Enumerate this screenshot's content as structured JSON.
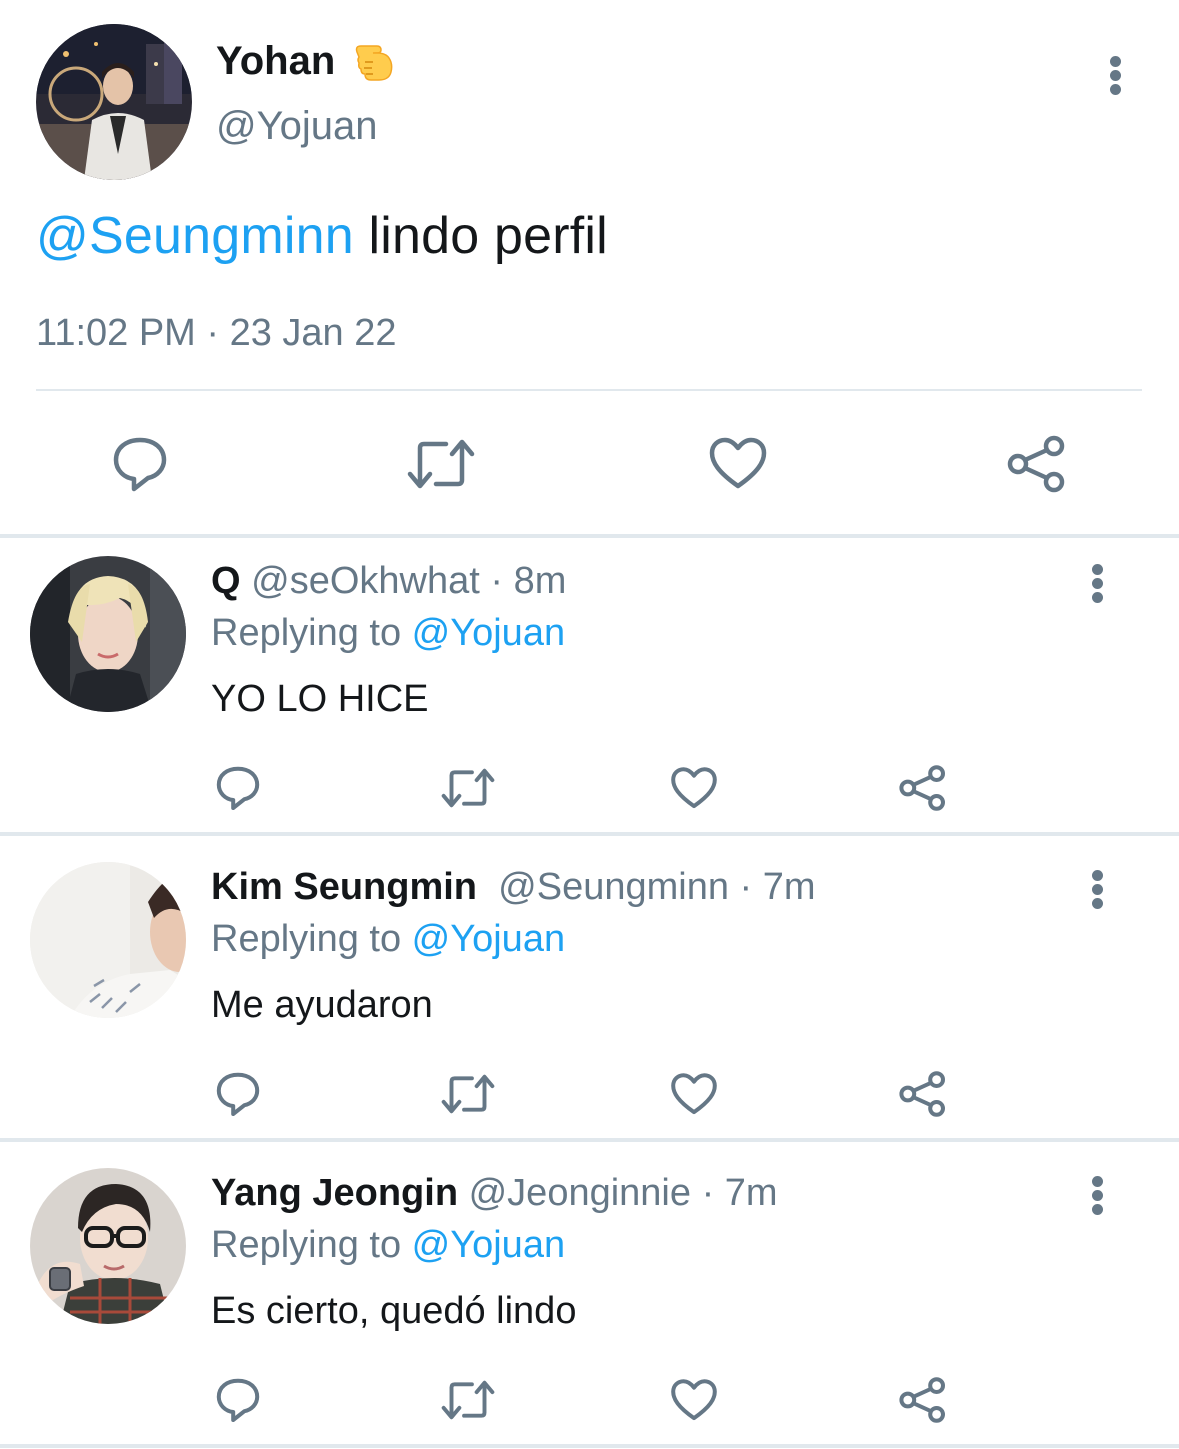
{
  "main_tweet": {
    "display_name": "Yohan",
    "name_emoji": "backhand-index-pointing-left-emoji",
    "handle": "@Yojuan",
    "mention": "@Seungminn",
    "text": " lindo perfil",
    "timestamp": "11:02 PM · 23 Jan 22",
    "actions": [
      "reply-icon",
      "retweet-icon",
      "like-icon",
      "share-icon"
    ]
  },
  "replies": [
    {
      "display_name": "Q",
      "handle": "@seOkhwhat",
      "time": " · 8m",
      "replying_label": "Replying to ",
      "replying_to": "@Yojuan",
      "text": "YO LO HICE"
    },
    {
      "display_name": "Kim Seungmin",
      "handle": "@Seungminn",
      "time": " · 7m",
      "replying_label": "Replying to ",
      "replying_to": "@Yojuan",
      "text": "Me ayudaron"
    },
    {
      "display_name": "Yang Jeongin",
      "handle": "@Jeonginnie",
      "time": " · 7m",
      "replying_label": "Replying to ",
      "replying_to": "@Yojuan",
      "text": "Es cierto, quedó lindo"
    }
  ],
  "colors": {
    "accent": "#1da1f2",
    "secondary_text": "#657786",
    "primary_text": "#14171a",
    "divider": "#e1e8ed"
  }
}
